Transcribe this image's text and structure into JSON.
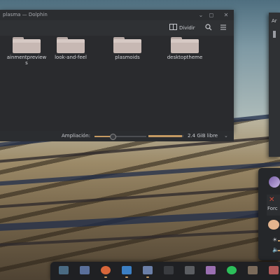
{
  "dolphin": {
    "title": "plasma — Dolphin",
    "split_label": "Dividir",
    "folders": [
      {
        "label": "ainmentpreview",
        "label2": "s"
      },
      {
        "label": "look-and-feel",
        "label2": ""
      },
      {
        "label": "plasmoids",
        "label2": ""
      },
      {
        "label": "desktoptheme",
        "label2": ""
      }
    ],
    "zoom_label": "Ampliación:",
    "zoom_level": 0.35,
    "free_space_label": "2.4 GiB libre",
    "disk_usage_fraction": 0.95
  },
  "window_buttons": {
    "minimize": "⌄",
    "maximize": "◻",
    "close": "✕"
  },
  "right_window": {
    "title_fragment": "Ar"
  },
  "panel": {
    "force_label": "Forc",
    "force_icon": "✕"
  },
  "taskbar": {
    "items": [
      {
        "name": "app-launcher-icon",
        "color": "#4a6a82"
      },
      {
        "name": "desktop-icon",
        "color": "#5a6f9a"
      },
      {
        "name": "firefox-icon",
        "color": "#d8663a"
      },
      {
        "name": "dolphin-icon",
        "color": "#3c7fc4"
      },
      {
        "name": "image-viewer-icon",
        "color": "#6b7fa8"
      },
      {
        "name": "terminal-icon",
        "color": "#3a3c40"
      },
      {
        "name": "calculator-icon",
        "color": "#5c5e62"
      },
      {
        "name": "document-icon",
        "color": "#9b6fb1"
      },
      {
        "name": "spotify-icon",
        "color": "#2cbf5a"
      },
      {
        "name": "book-icon",
        "color": "#7a6a5a"
      },
      {
        "name": "office-icon",
        "color": "#b05a5a"
      }
    ]
  }
}
